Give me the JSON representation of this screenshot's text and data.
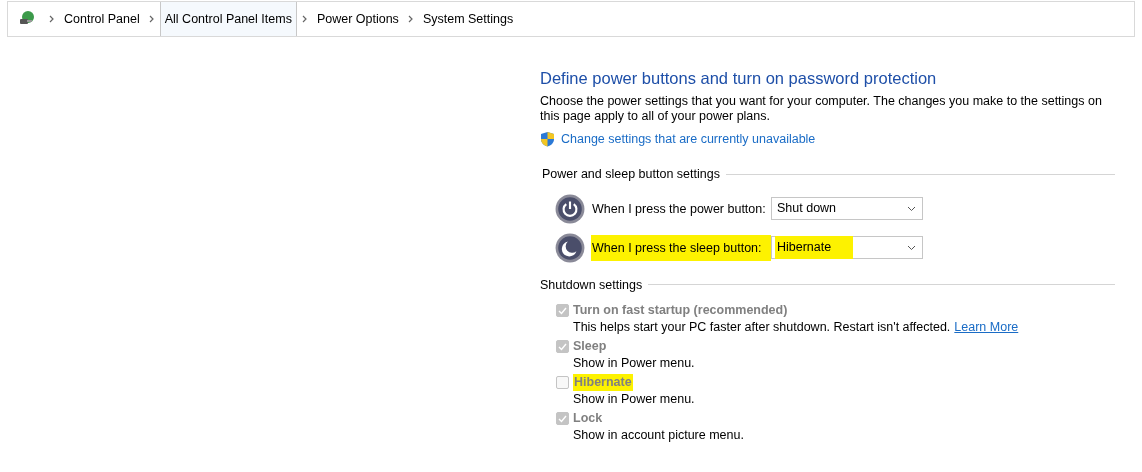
{
  "breadcrumb": [
    {
      "label": "Control Panel",
      "selected": false
    },
    {
      "label": "All Control Panel Items",
      "selected": true
    },
    {
      "label": "Power Options",
      "selected": false
    },
    {
      "label": "System Settings",
      "selected": false
    }
  ],
  "heading": "Define power buttons and turn on password protection",
  "description": "Choose the power settings that you want for your computer. The changes you make to the settings on this page apply to all of your power plans.",
  "admin_link": "Change settings that are currently unavailable",
  "button_section": {
    "title": "Power and sleep button settings",
    "rows": [
      {
        "kind": "power",
        "label": "When I press the power button:",
        "value": "Shut down",
        "highlighted": false
      },
      {
        "kind": "sleep",
        "label": "When I press the sleep button:",
        "value": "Hibernate",
        "highlighted": true
      }
    ]
  },
  "shutdown_section": {
    "title": "Shutdown settings",
    "items": [
      {
        "label": "Turn on fast startup (recommended)",
        "checked": true,
        "disabled": true,
        "highlighted": false,
        "note": "This helps start your PC faster after shutdown. Restart isn't affected.",
        "link": "Learn More"
      },
      {
        "label": "Sleep",
        "checked": true,
        "disabled": true,
        "highlighted": false,
        "note": "Show in Power menu."
      },
      {
        "label": "Hibernate",
        "checked": false,
        "disabled": true,
        "highlighted": true,
        "note": "Show in Power menu."
      },
      {
        "label": "Lock",
        "checked": true,
        "disabled": true,
        "highlighted": false,
        "note": "Show in account picture menu."
      }
    ]
  }
}
